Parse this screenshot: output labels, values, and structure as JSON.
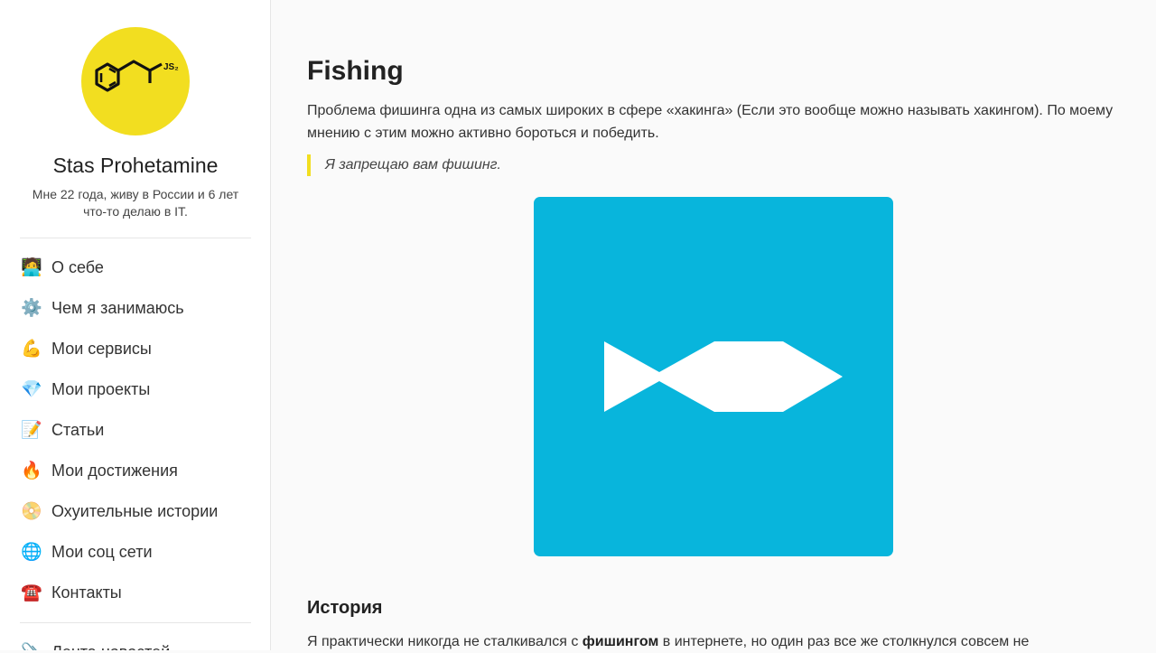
{
  "profile": {
    "name": "Stas Prohetamine",
    "bio": "Мне 22 года, живу в России и 6 лет что-то делаю в IT.",
    "logo_text": "JS₂",
    "accent_color": "#f2de20"
  },
  "nav": {
    "items": [
      {
        "icon": "🧑‍💻",
        "icon_name": "technologist-icon",
        "label": "О себе"
      },
      {
        "icon": "⚙️",
        "icon_name": "gear-icon",
        "label": "Чем я занимаюсь"
      },
      {
        "icon": "💪",
        "icon_name": "flexed-biceps-icon",
        "label": "Мои сервисы"
      },
      {
        "icon": "💎",
        "icon_name": "gem-icon",
        "label": "Мои проекты"
      },
      {
        "icon": "📝",
        "icon_name": "memo-icon",
        "label": "Статьи"
      },
      {
        "icon": "🔥",
        "icon_name": "fire-icon",
        "label": "Мои достижения"
      },
      {
        "icon": "📀",
        "icon_name": "dvd-icon",
        "label": "Охуительные истории"
      },
      {
        "icon": "🌐",
        "icon_name": "globe-icon",
        "label": "Мои соц сети"
      },
      {
        "icon": "☎️",
        "icon_name": "telephone-icon",
        "label": "Контакты"
      }
    ],
    "partial_item": {
      "icon": "📎",
      "icon_name": "paperclip-icon",
      "label": "Лента новостей"
    }
  },
  "article": {
    "title": "Fishing",
    "intro": "Проблема фишинга одна из самых широких в сфере «хакинга» (Если это вообще можно называть хакингом). По моему мнению с этим можно активно бороться и победить.",
    "quote": "Я запрещаю вам фишинг.",
    "image_color": "#08b5dc",
    "image_icon": "fish-icon",
    "section_title": "История",
    "story_before": "Я практически никогда не сталкивался с ",
    "story_bold": "фишингом",
    "story_after": " в интернете, но один раз все же столкнулся совсем не"
  }
}
